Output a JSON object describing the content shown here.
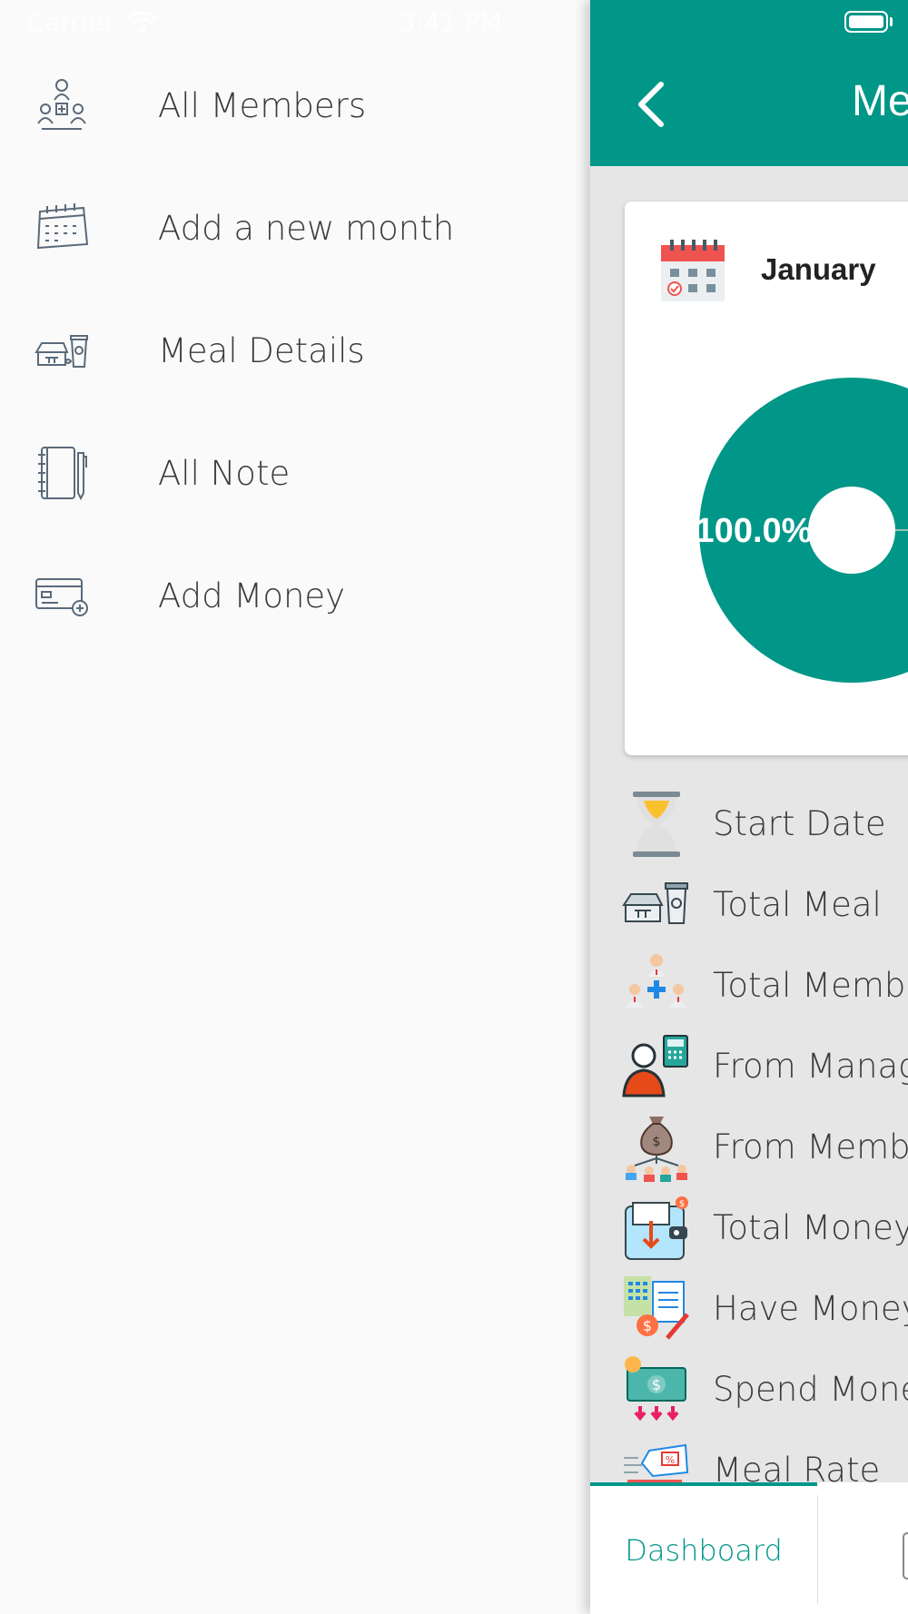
{
  "status": {
    "carrier": "Carrier",
    "time": "3:41 PM"
  },
  "drawer": {
    "items": [
      {
        "label": "All Members",
        "icon": "members-icon"
      },
      {
        "label": "Add a new month",
        "icon": "calendar-icon"
      },
      {
        "label": "Meal Details",
        "icon": "meal-icon"
      },
      {
        "label": "All Note",
        "icon": "notebook-icon"
      },
      {
        "label": "Add Money",
        "icon": "credit-card-icon"
      }
    ]
  },
  "header": {
    "title": "Me"
  },
  "card": {
    "month": "January",
    "pie_label": "100.0%"
  },
  "chart_data": {
    "type": "pie",
    "slices": [
      {
        "label": "100.0%",
        "value": 100.0
      }
    ],
    "colors": [
      "#009688"
    ]
  },
  "rows": [
    {
      "label": "Start Date",
      "icon": "hourglass-icon"
    },
    {
      "label": "Total Meal",
      "icon": "meal-icon"
    },
    {
      "label": "Total Membe",
      "icon": "members-icon"
    },
    {
      "label": "From Manag",
      "icon": "manager-calculator-icon"
    },
    {
      "label": "From Memb",
      "icon": "money-bag-icon"
    },
    {
      "label": "Total Money",
      "icon": "wallet-icon"
    },
    {
      "label": "Have Money",
      "icon": "calculator-coin-icon"
    },
    {
      "label": "Spend Mone",
      "icon": "spend-money-icon"
    },
    {
      "label": "Meal Rate",
      "icon": "price-tag-icon"
    }
  ],
  "tabbar": {
    "dashboard": "Dashboard"
  },
  "colors": {
    "primary": "#009688",
    "background": "#e6e6e6"
  }
}
